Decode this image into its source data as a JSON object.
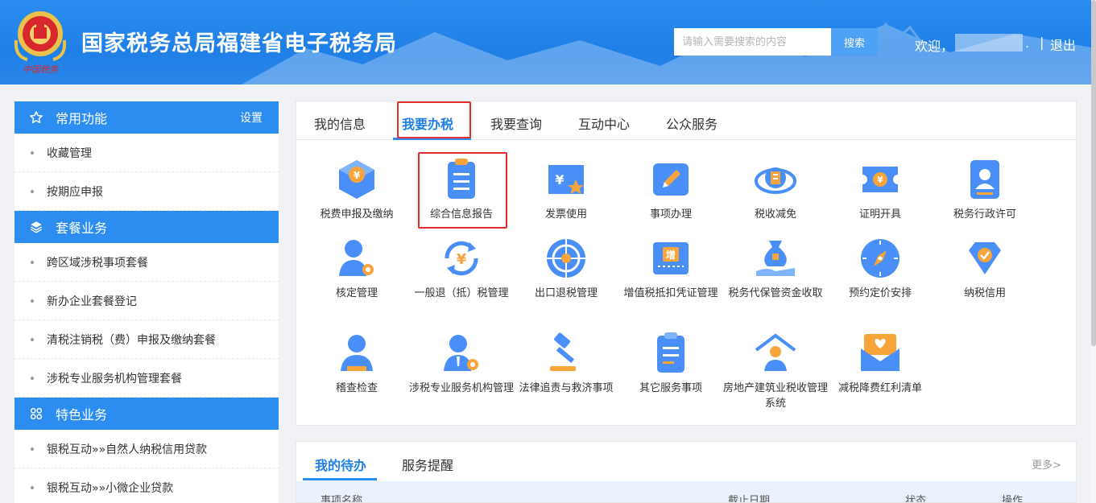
{
  "header": {
    "title": "国家税务总局福建省电子税务局",
    "search_placeholder": "请输入需要搜索的内容",
    "search_button": "搜索",
    "welcome": "欢迎，",
    "dot": ".",
    "separator": "|",
    "logout": "退出",
    "brand_color": "#1f7fe6"
  },
  "sidebar": {
    "sections": [
      {
        "title": "常用功能",
        "icon": "star-icon",
        "setting": "设置",
        "items": [
          "收藏管理",
          "按期应申报"
        ]
      },
      {
        "title": "套餐业务",
        "icon": "layers-icon",
        "items": [
          "跨区域涉税事项套餐",
          "新办企业套餐登记",
          "清税注销税（费）申报及缴纳套餐",
          "涉税专业服务机构管理套餐"
        ]
      },
      {
        "title": "特色业务",
        "icon": "grid-icon",
        "items": [
          "银税互动»»自然人纳税信用贷款",
          "银税互动»»小微企业贷款"
        ]
      }
    ]
  },
  "main": {
    "tabs": [
      "我的信息",
      "我要办税",
      "我要查询",
      "互动中心",
      "公众服务"
    ],
    "active_tab": "我要办税",
    "functions": [
      {
        "label": "税费申报及缴纳",
        "icon": "tax-declare-icon"
      },
      {
        "label": "综合信息报告",
        "icon": "document-report-icon"
      },
      {
        "label": "发票使用",
        "icon": "invoice-icon"
      },
      {
        "label": "事项办理",
        "icon": "pen-edit-icon"
      },
      {
        "label": "税收减免",
        "icon": "tax-relief-icon"
      },
      {
        "label": "证明开具",
        "icon": "certificate-icon"
      },
      {
        "label": "税务行政许可",
        "icon": "license-icon"
      },
      {
        "label": "核定管理",
        "icon": "person-gear-icon"
      },
      {
        "label": "一般退（抵）税管理",
        "icon": "refund-icon"
      },
      {
        "label": "出口退税管理",
        "icon": "globe-icon"
      },
      {
        "label": "增值税抵扣凭证管理",
        "icon": "vat-voucher-icon"
      },
      {
        "label": "税务代保管资金收取",
        "icon": "money-bag-icon"
      },
      {
        "label": "预约定价安排",
        "icon": "compass-icon"
      },
      {
        "label": "纳税信用",
        "icon": "diamond-check-icon"
      },
      {
        "label": "稽查检查",
        "icon": "inspector-icon"
      },
      {
        "label": "涉税专业服务机构管理",
        "icon": "agency-gear-icon"
      },
      {
        "label": "法律追责与救济事项",
        "icon": "gavel-icon"
      },
      {
        "label": "其它服务事项",
        "icon": "clipboard-icon"
      },
      {
        "label": "房地产建筑业税收管理系统",
        "icon": "house-person-icon"
      },
      {
        "label": "减税降费红利清单",
        "icon": "envelope-heart-icon"
      }
    ]
  },
  "todo": {
    "tabs": [
      "我的待办",
      "服务提醒"
    ],
    "more": "更多>",
    "columns": [
      "事项名称",
      "截止日期",
      "状态",
      "操作"
    ]
  }
}
